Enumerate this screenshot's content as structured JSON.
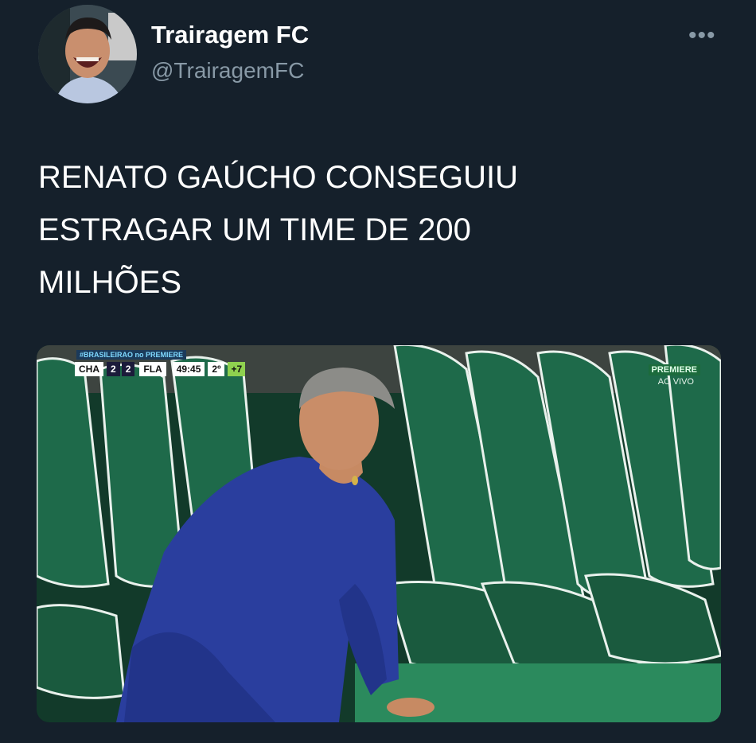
{
  "tweet": {
    "author_name": "Trairagem FC",
    "author_handle": "@TrairagemFC",
    "more_icon": "more-horizontal-icon",
    "text_lines": [
      "RENATO GAÚCHO CONSEGUIU",
      "ESTRAGAR UM TIME DE 200",
      "MILHÕES"
    ]
  },
  "media": {
    "scorebug": {
      "competition": "#BRASILEIRAO no PREMIERE",
      "home_team": "CHA",
      "home_score": "2",
      "away_score": "2",
      "away_team": "FLA",
      "clock": "49:45",
      "period": "2º",
      "added_time": "+7"
    },
    "broadcaster": "PREMIERE",
    "live_label": "AO VIVO"
  },
  "colors": {
    "background": "#15202b",
    "handle_gray": "#8899a6",
    "seat_green": "#1f6b4a",
    "shirt_blue": "#2a3e9e"
  }
}
